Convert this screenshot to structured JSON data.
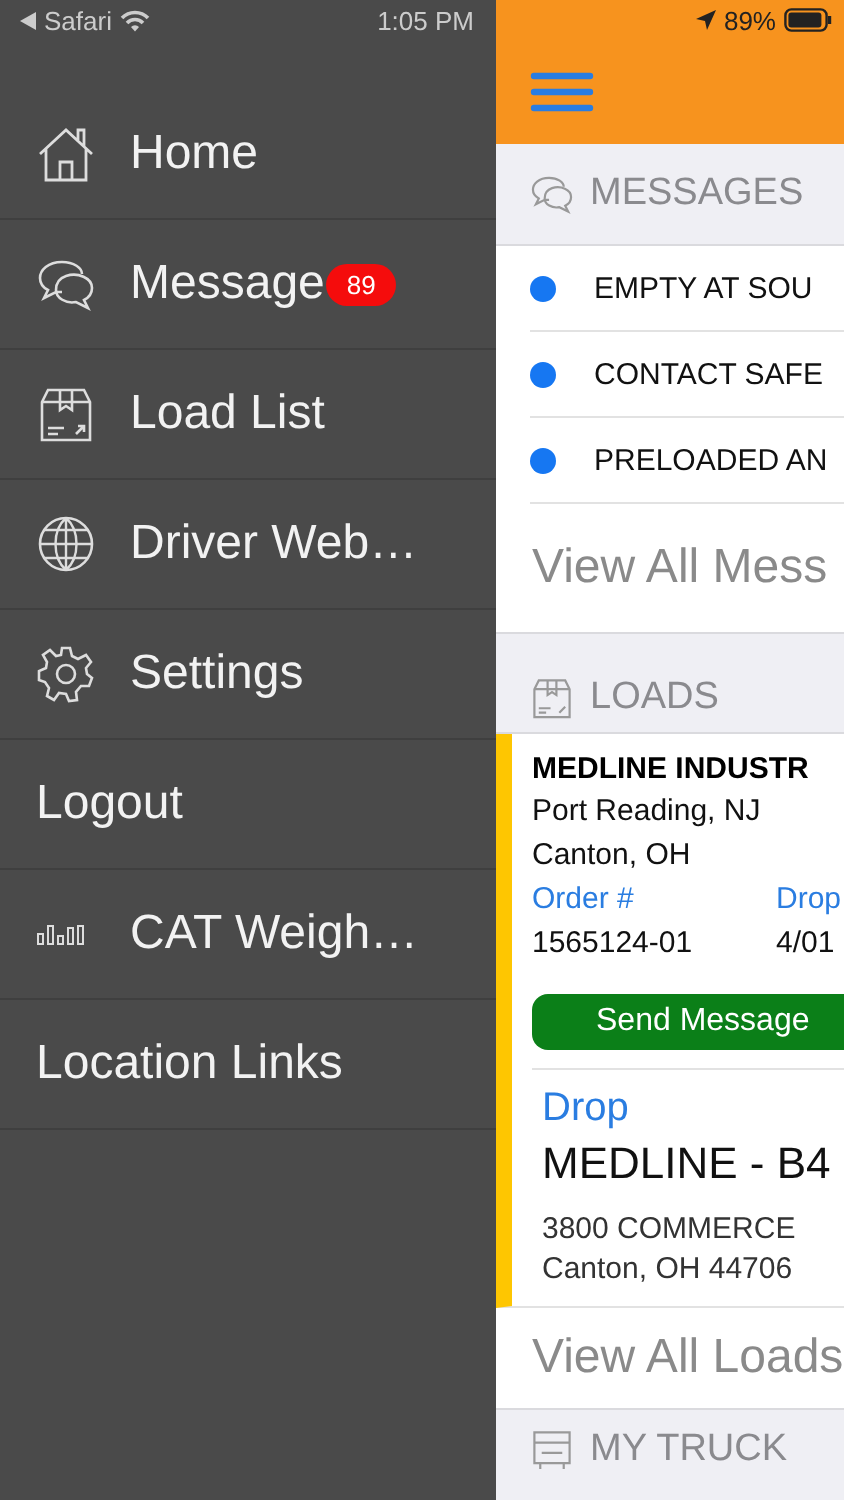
{
  "status_bar": {
    "back_app": "Safari",
    "time": "1:05 PM",
    "battery": "89%"
  },
  "drawer": {
    "items": [
      {
        "label": "Home",
        "kind": "icon_row"
      },
      {
        "label": "Message",
        "kind": "icon_row",
        "badge": "89"
      },
      {
        "label": "Load List",
        "kind": "icon_row"
      },
      {
        "label": "Driver Web…",
        "kind": "icon_row"
      },
      {
        "label": "Settings",
        "kind": "icon_row"
      },
      {
        "label": "Logout",
        "kind": "text_row"
      },
      {
        "label": "CAT Weigh…",
        "kind": "icon_row"
      },
      {
        "label": "Location Links",
        "kind": "text_row"
      }
    ]
  },
  "messages": {
    "title": "MESSAGES",
    "items": [
      {
        "text": "EMPTY AT SOU",
        "unread": true
      },
      {
        "text": "CONTACT SAFE",
        "unread": true
      },
      {
        "text": "PRELOADED AN",
        "unread": true
      }
    ],
    "view_all": "View All Mess"
  },
  "loads": {
    "title": "LOADS",
    "card": {
      "customer": "MEDLINE INDUSTR",
      "origin": "Port Reading, NJ",
      "destination": "Canton, OH",
      "fields": [
        {
          "label": "Order #",
          "value": "1565124-01"
        },
        {
          "label": "Drop",
          "value": "4/01"
        }
      ],
      "button": "Send Message",
      "stop": {
        "type": "Drop",
        "name": "MEDLINE - B4",
        "address": [
          "3800 COMMERCE",
          "Canton, OH 44706"
        ]
      }
    },
    "view_all": "View All Loads"
  },
  "truck": {
    "title": "MY TRUCK"
  }
}
